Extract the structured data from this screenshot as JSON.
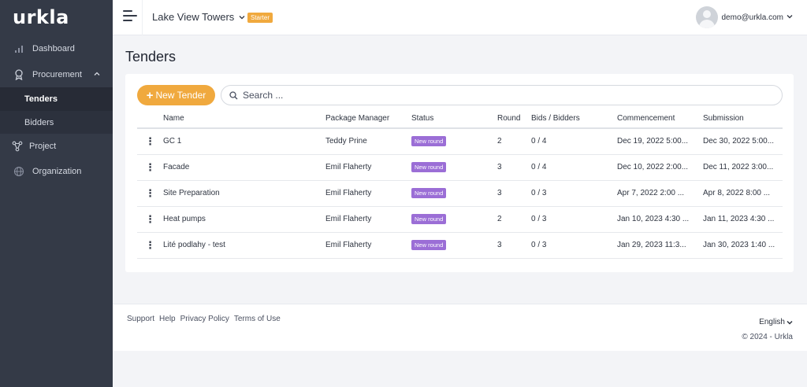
{
  "brand": {
    "name": "urkla",
    "accent": "#f0a93e",
    "sidebar_bg": "#343a47"
  },
  "sidebar": {
    "items": [
      {
        "label": "Dashboard",
        "icon": "bar-chart-icon"
      },
      {
        "label": "Procurement",
        "icon": "award-icon",
        "expanded": true
      },
      {
        "label": "Tenders",
        "sub": true,
        "active": true
      },
      {
        "label": "Bidders",
        "sub": true
      },
      {
        "label": "Project",
        "icon": "network-icon"
      },
      {
        "label": "Organization",
        "icon": "globe-icon"
      }
    ]
  },
  "topbar": {
    "project_name": "Lake View Towers",
    "plan_badge": "Starter",
    "user_email": "demo@urkla.com"
  },
  "main": {
    "title": "Tenders",
    "new_button": "New Tender",
    "search_placeholder": "Search ...",
    "columns": [
      "Name",
      "Package Manager",
      "Status",
      "Round",
      "Bids / Bidders",
      "Commencement",
      "Submission"
    ],
    "rows": [
      {
        "name": "GC 1",
        "manager": "Teddy Prine",
        "status": "New round",
        "round": "2",
        "bids": "0 / 4",
        "commencement": "Dec 19, 2022 5:00...",
        "submission": "Dec 30, 2022 5:00..."
      },
      {
        "name": "Facade",
        "manager": "Emil Flaherty",
        "status": "New round",
        "round": "3",
        "bids": "0 / 4",
        "commencement": "Dec 10, 2022 2:00...",
        "submission": "Dec 11, 2022 3:00..."
      },
      {
        "name": "Site Preparation",
        "manager": "Emil Flaherty",
        "status": "New round",
        "round": "3",
        "bids": "0 / 3",
        "commencement": "Apr 7, 2022 2:00 ...",
        "submission": "Apr 8, 2022 8:00 ..."
      },
      {
        "name": "Heat pumps",
        "manager": "Emil Flaherty",
        "status": "New round",
        "round": "2",
        "bids": "0 / 3",
        "commencement": "Jan 10, 2023 4:30 ...",
        "submission": "Jan 11, 2023 4:30 ..."
      },
      {
        "name": "Lité podlahy - test",
        "manager": "Emil Flaherty",
        "status": "New round",
        "round": "3",
        "bids": "0 / 3",
        "commencement": "Jan 29, 2023 11:3...",
        "submission": "Jan 30, 2023 1:40 ..."
      }
    ]
  },
  "footer": {
    "links": [
      "Support",
      "Help",
      "Privacy Policy",
      "Terms of Use"
    ],
    "language": "English",
    "copyright": "© 2024 - Urkla"
  }
}
